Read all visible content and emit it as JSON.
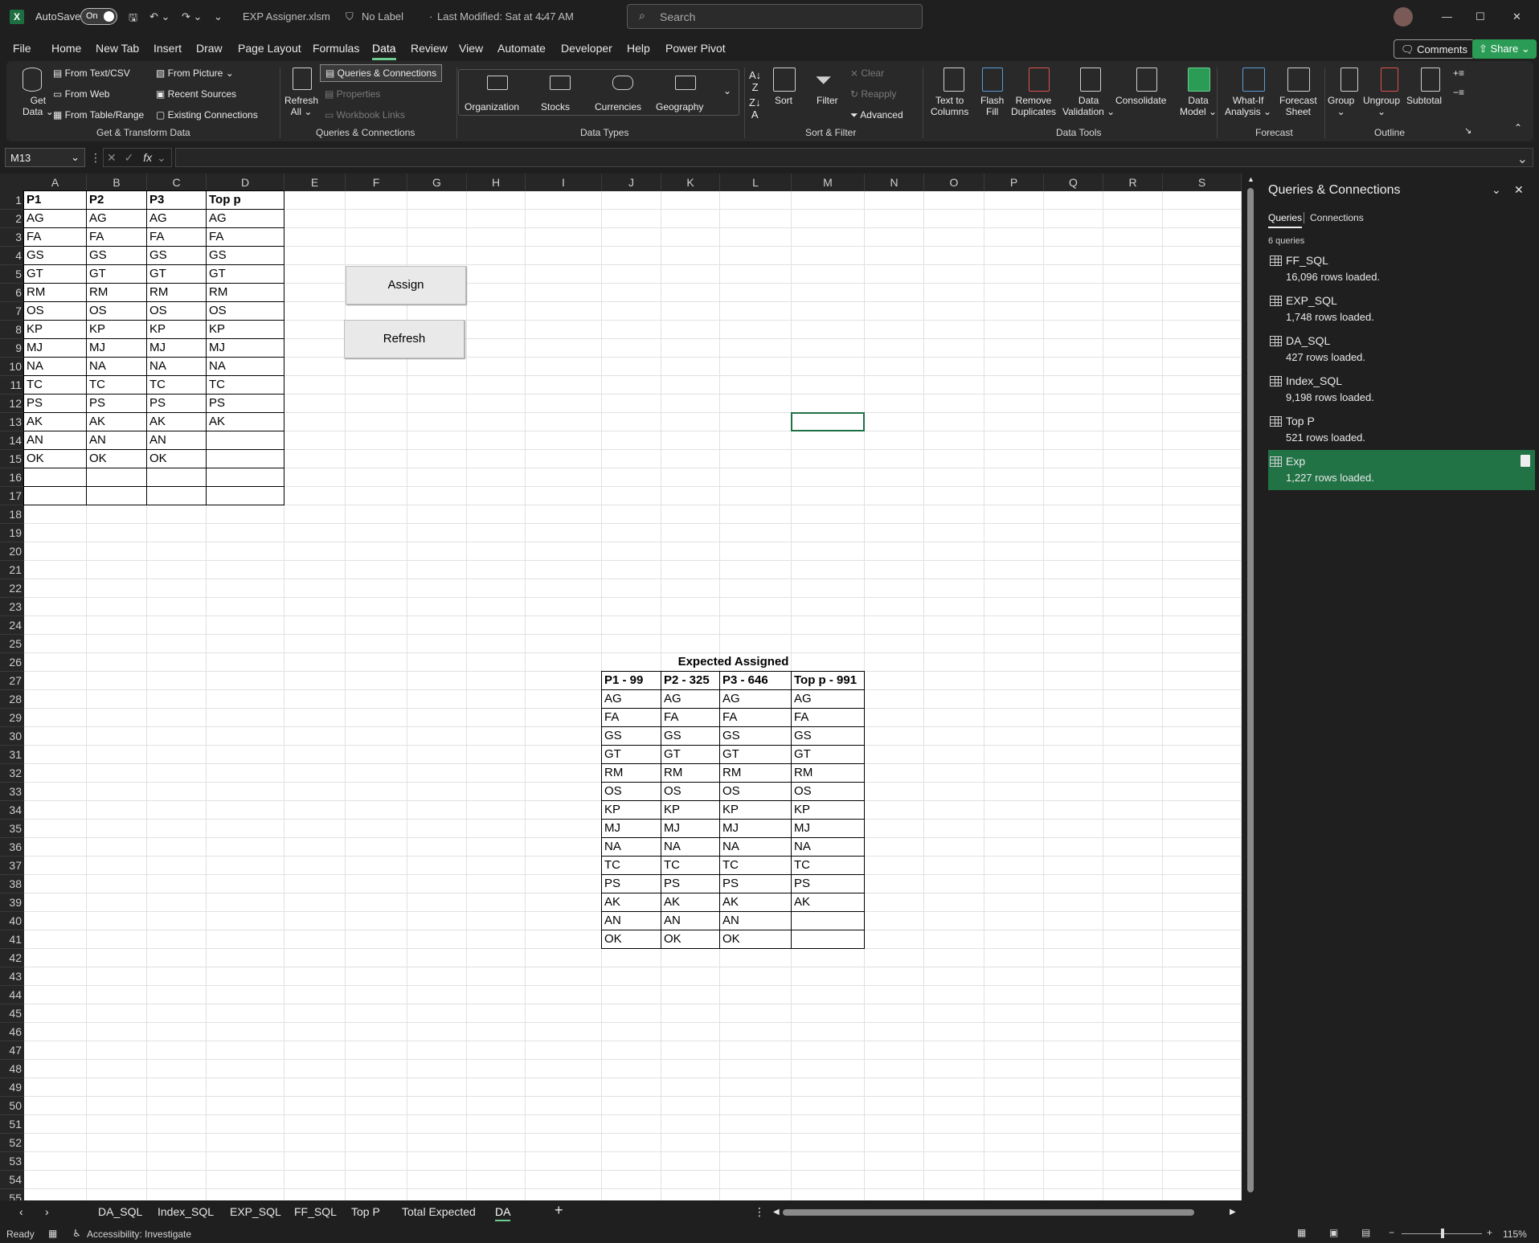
{
  "titlebar": {
    "autosave_label": "AutoSave",
    "autosave_state": "On",
    "filename": "EXP Assigner.xlsm",
    "label": "No Label",
    "modified": "Last Modified: Sat at 4:47 AM",
    "search_placeholder": "Search"
  },
  "menu": {
    "items": [
      "File",
      "Home",
      "New Tab",
      "Insert",
      "Draw",
      "Page Layout",
      "Formulas",
      "Data",
      "Review",
      "View",
      "Automate",
      "Developer",
      "Help",
      "Power Pivot"
    ],
    "active": "Data",
    "comments": "Comments",
    "share": "Share"
  },
  "ribbon": {
    "get_transform": {
      "get_data": "Get",
      "get_data2": "Data",
      "from_text": "From Text/CSV",
      "from_web": "From Web",
      "from_table": "From Table/Range",
      "from_picture": "From Picture",
      "recent_sources": "Recent Sources",
      "existing_connections": "Existing Connections",
      "group": "Get & Transform Data"
    },
    "queries": {
      "refresh": "Refresh",
      "refresh2": "All",
      "queries_connections": "Queries & Connections",
      "properties": "Properties",
      "workbook_links": "Workbook Links",
      "group": "Queries & Connections"
    },
    "data_types": {
      "organization": "Organization",
      "stocks": "Stocks",
      "currencies": "Currencies",
      "geography": "Geography",
      "group": "Data Types"
    },
    "sort_filter": {
      "sort": "Sort",
      "filter": "Filter",
      "clear": "Clear",
      "reapply": "Reapply",
      "advanced": "Advanced",
      "group": "Sort & Filter"
    },
    "data_tools": {
      "text_to_columns": "Text to",
      "text_to_columns2": "Columns",
      "flash_fill": "Flash",
      "flash_fill2": "Fill",
      "remove_duplicates": "Remove",
      "remove_duplicates2": "Duplicates",
      "data_validation": "Data",
      "data_validation2": "Validation",
      "consolidate": "Consolidate",
      "data_model": "Data",
      "data_model2": "Model",
      "group": "Data Tools"
    },
    "forecast": {
      "what_if": "What-If",
      "what_if2": "Analysis",
      "forecast_sheet": "Forecast",
      "forecast_sheet2": "Sheet",
      "group": "Forecast"
    },
    "outline": {
      "group_btn": "Group",
      "ungroup": "Ungroup",
      "subtotal": "Subtotal",
      "group": "Outline"
    }
  },
  "formula": {
    "namebox": "M13",
    "fx": "fx",
    "value": ""
  },
  "columns": [
    "A",
    "B",
    "C",
    "D",
    "E",
    "F",
    "G",
    "H",
    "I",
    "J",
    "K",
    "L",
    "M",
    "N",
    "O",
    "P",
    "Q",
    "R",
    "S"
  ],
  "rows": [
    "1",
    "2",
    "3",
    "4",
    "5",
    "6",
    "7",
    "8",
    "9",
    "10",
    "11",
    "12",
    "13",
    "14",
    "15",
    "16",
    "17",
    "18",
    "19",
    "20",
    "21",
    "22",
    "23",
    "24",
    "25",
    "26",
    "27",
    "28",
    "29",
    "30",
    "31",
    "32",
    "33",
    "34",
    "35",
    "36",
    "37",
    "38",
    "39",
    "40",
    "41",
    "42",
    "43",
    "44",
    "45",
    "46",
    "47",
    "48",
    "49",
    "50",
    "51",
    "52",
    "53",
    "54",
    "55"
  ],
  "table1": {
    "headers": [
      "P1",
      "P2",
      "P3",
      "Top p"
    ],
    "rows": [
      [
        "AG",
        "AG",
        "AG",
        "AG"
      ],
      [
        "FA",
        "FA",
        "FA",
        "FA"
      ],
      [
        "GS",
        "GS",
        "GS",
        "GS"
      ],
      [
        "GT",
        "GT",
        "GT",
        "GT"
      ],
      [
        "RM",
        "RM",
        "RM",
        "RM"
      ],
      [
        "OS",
        "OS",
        "OS",
        "OS"
      ],
      [
        "KP",
        "KP",
        "KP",
        "KP"
      ],
      [
        "MJ",
        "MJ",
        "MJ",
        "MJ"
      ],
      [
        "NA",
        "NA",
        "NA",
        "NA"
      ],
      [
        "TC",
        "TC",
        "TC",
        "TC"
      ],
      [
        "PS",
        "PS",
        "PS",
        "PS"
      ],
      [
        "AK",
        "AK",
        "AK",
        "AK"
      ],
      [
        "AN",
        "AN",
        "AN",
        ""
      ],
      [
        "OK",
        "OK",
        "OK",
        ""
      ],
      [
        "",
        "",
        "",
        ""
      ],
      [
        "",
        "",
        "",
        ""
      ]
    ]
  },
  "buttons": {
    "assign": "Assign",
    "refresh": "Refresh"
  },
  "table2": {
    "title": "Expected Assigned",
    "headers": [
      "P1 - 99",
      "P2 - 325",
      "P3 - 646",
      "Top p - 991"
    ],
    "rows": [
      [
        "AG",
        "AG",
        "AG",
        "AG"
      ],
      [
        "FA",
        "FA",
        "FA",
        "FA"
      ],
      [
        "GS",
        "GS",
        "GS",
        "GS"
      ],
      [
        "GT",
        "GT",
        "GT",
        "GT"
      ],
      [
        "RM",
        "RM",
        "RM",
        "RM"
      ],
      [
        "OS",
        "OS",
        "OS",
        "OS"
      ],
      [
        "KP",
        "KP",
        "KP",
        "KP"
      ],
      [
        "MJ",
        "MJ",
        "MJ",
        "MJ"
      ],
      [
        "NA",
        "NA",
        "NA",
        "NA"
      ],
      [
        "TC",
        "TC",
        "TC",
        "TC"
      ],
      [
        "PS",
        "PS",
        "PS",
        "PS"
      ],
      [
        "AK",
        "AK",
        "AK",
        "AK"
      ],
      [
        "AN",
        "AN",
        "AN",
        ""
      ],
      [
        "OK",
        "OK",
        "OK",
        ""
      ]
    ]
  },
  "panel": {
    "title": "Queries & Connections",
    "tab_queries": "Queries",
    "tab_connections": "Connections",
    "count": "6 queries",
    "queries": [
      {
        "name": "FF_SQL",
        "rows": "16,096 rows loaded."
      },
      {
        "name": "EXP_SQL",
        "rows": "1,748 rows loaded."
      },
      {
        "name": "DA_SQL",
        "rows": "427 rows loaded."
      },
      {
        "name": "Index_SQL",
        "rows": "9,198 rows loaded."
      },
      {
        "name": "Top P",
        "rows": "521 rows loaded."
      },
      {
        "name": "Exp",
        "rows": "1,227 rows loaded."
      }
    ],
    "selected": "Exp",
    "accent": "#217346"
  },
  "sheets": {
    "tabs": [
      "DA_SQL",
      "Index_SQL",
      "EXP_SQL",
      "FF_SQL",
      "Top P",
      "Total Expected",
      "DA"
    ],
    "active": "DA"
  },
  "status": {
    "ready": "Ready",
    "accessibility": "Accessibility: Investigate",
    "zoom": "115%"
  }
}
